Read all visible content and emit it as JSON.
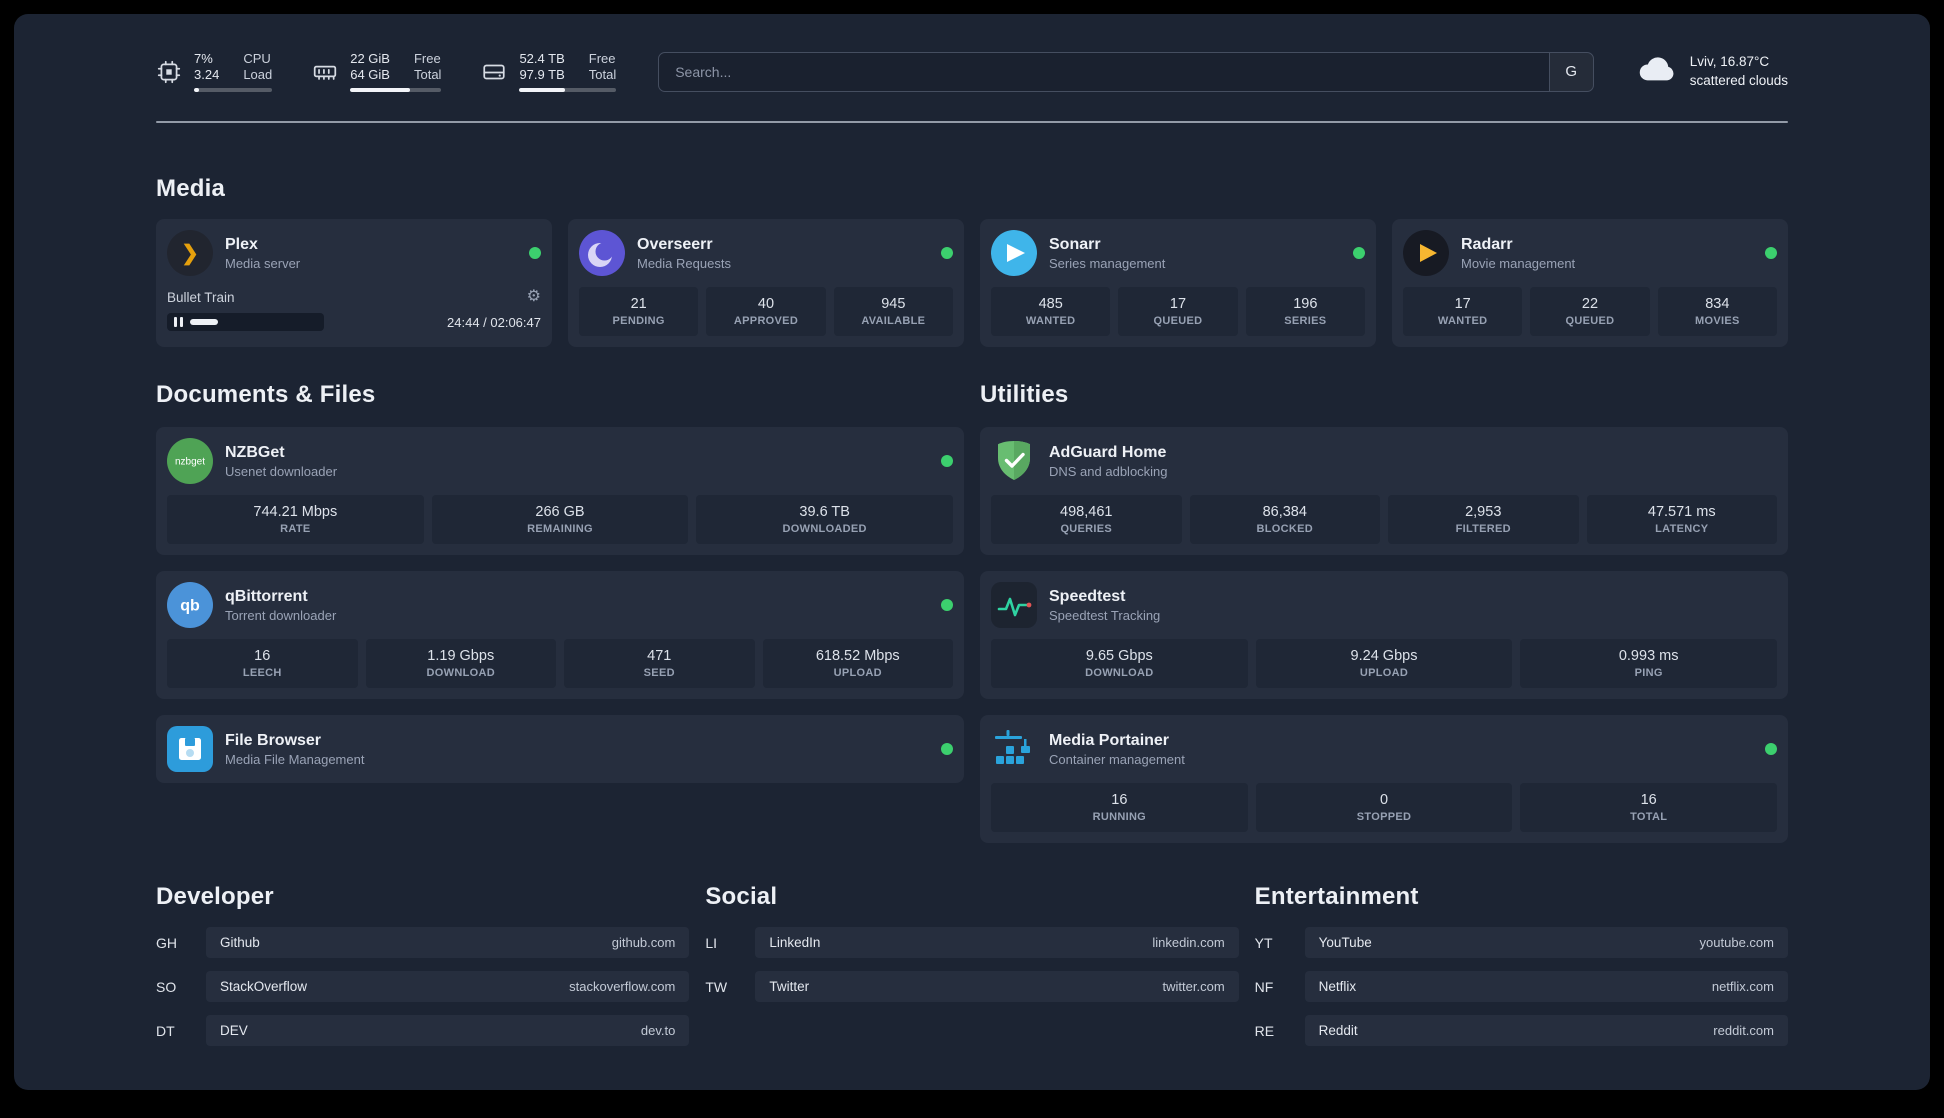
{
  "colors": {
    "status_online": "#3ccf6e",
    "page_bg": "#1c2433",
    "card_bg": "#262e3e"
  },
  "topbar": {
    "resources": [
      {
        "id": "cpu",
        "value_top": "7%",
        "value_bottom": "3.24",
        "label_top": "CPU",
        "label_bottom": "Load",
        "progress_pct": 7
      },
      {
        "id": "memory",
        "value_top": "22 GiB",
        "value_bottom": "64 GiB",
        "label_top": "Free",
        "label_bottom": "Total",
        "progress_pct": 66
      },
      {
        "id": "disk",
        "value_top": "52.4 TB",
        "value_bottom": "97.9 TB",
        "label_top": "Free",
        "label_bottom": "Total",
        "progress_pct": 47
      }
    ],
    "search": {
      "placeholder": "Search...",
      "engine_button": "G"
    },
    "weather": {
      "location": "Lviv, 16.87°C",
      "condition": "scattered clouds"
    }
  },
  "media": {
    "title": "Media",
    "cards": [
      {
        "name": "Plex",
        "subtitle": "Media server",
        "status": "online",
        "player": {
          "track": "Bullet Train",
          "time": "24:44 / 02:06:47",
          "progress_pct": 20
        }
      },
      {
        "name": "Overseerr",
        "subtitle": "Media Requests",
        "status": "online",
        "stats": [
          {
            "value": "21",
            "label": "PENDING"
          },
          {
            "value": "40",
            "label": "APPROVED"
          },
          {
            "value": "945",
            "label": "AVAILABLE"
          }
        ]
      },
      {
        "name": "Sonarr",
        "subtitle": "Series management",
        "status": "online",
        "stats": [
          {
            "value": "485",
            "label": "WANTED"
          },
          {
            "value": "17",
            "label": "QUEUED"
          },
          {
            "value": "196",
            "label": "SERIES"
          }
        ]
      },
      {
        "name": "Radarr",
        "subtitle": "Movie management",
        "status": "online",
        "stats": [
          {
            "value": "17",
            "label": "WANTED"
          },
          {
            "value": "22",
            "label": "QUEUED"
          },
          {
            "value": "834",
            "label": "MOVIES"
          }
        ]
      }
    ]
  },
  "documents": {
    "title": "Documents & Files",
    "cards": [
      {
        "name": "NZBGet",
        "subtitle": "Usenet downloader",
        "status": "online",
        "stats": [
          {
            "value": "744.21 Mbps",
            "label": "RATE"
          },
          {
            "value": "266 GB",
            "label": "REMAINING"
          },
          {
            "value": "39.6 TB",
            "label": "DOWNLOADED"
          }
        ]
      },
      {
        "name": "qBittorrent",
        "subtitle": "Torrent downloader",
        "status": "online",
        "stats": [
          {
            "value": "16",
            "label": "LEECH"
          },
          {
            "value": "1.19 Gbps",
            "label": "DOWNLOAD"
          },
          {
            "value": "471",
            "label": "SEED"
          },
          {
            "value": "618.52 Mbps",
            "label": "UPLOAD"
          }
        ]
      },
      {
        "name": "File Browser",
        "subtitle": "Media File Management",
        "status": "online",
        "stats": []
      }
    ]
  },
  "utilities": {
    "title": "Utilities",
    "cards": [
      {
        "name": "AdGuard Home",
        "subtitle": "DNS and adblocking",
        "stats": [
          {
            "value": "498,461",
            "label": "QUERIES"
          },
          {
            "value": "86,384",
            "label": "BLOCKED"
          },
          {
            "value": "2,953",
            "label": "FILTERED"
          },
          {
            "value": "47.571 ms",
            "label": "LATENCY"
          }
        ]
      },
      {
        "name": "Speedtest",
        "subtitle": "Speedtest Tracking",
        "stats": [
          {
            "value": "9.65 Gbps",
            "label": "DOWNLOAD"
          },
          {
            "value": "9.24 Gbps",
            "label": "UPLOAD"
          },
          {
            "value": "0.993 ms",
            "label": "PING"
          }
        ]
      },
      {
        "name": "Media Portainer",
        "subtitle": "Container management",
        "status": "online",
        "stats": [
          {
            "value": "16",
            "label": "RUNNING"
          },
          {
            "value": "0",
            "label": "STOPPED"
          },
          {
            "value": "16",
            "label": "TOTAL"
          }
        ]
      }
    ]
  },
  "bookmarks": {
    "groups": [
      {
        "title": "Developer",
        "items": [
          {
            "abbr": "GH",
            "name": "Github",
            "url": "github.com"
          },
          {
            "abbr": "SO",
            "name": "StackOverflow",
            "url": "stackoverflow.com"
          },
          {
            "abbr": "DT",
            "name": "DEV",
            "url": "dev.to"
          }
        ]
      },
      {
        "title": "Social",
        "items": [
          {
            "abbr": "LI",
            "name": "LinkedIn",
            "url": "linkedin.com"
          },
          {
            "abbr": "TW",
            "name": "Twitter",
            "url": "twitter.com"
          }
        ]
      },
      {
        "title": "Entertainment",
        "items": [
          {
            "abbr": "YT",
            "name": "YouTube",
            "url": "youtube.com"
          },
          {
            "abbr": "NF",
            "name": "Netflix",
            "url": "netflix.com"
          },
          {
            "abbr": "RE",
            "name": "Reddit",
            "url": "reddit.com"
          }
        ]
      }
    ]
  }
}
